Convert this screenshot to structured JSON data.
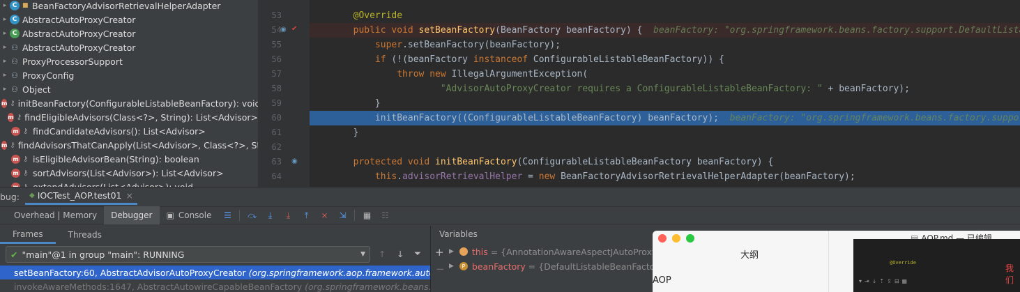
{
  "structure": {
    "items": [
      {
        "label": "BeanFactoryAdvisorRetrievalHelperAdapter",
        "icon": "class-icon",
        "mark": "lock"
      },
      {
        "label": "AbstractAutoProxyCreator",
        "icon": "class-icon"
      },
      {
        "label": "AbstractAutoProxyCreator",
        "icon": "class-icon"
      },
      {
        "label": "AbstractAutoProxyCreator",
        "icon": "hierarchy-icon"
      },
      {
        "label": "ProxyProcessorSupport",
        "icon": "hierarchy-icon"
      },
      {
        "label": "ProxyConfig",
        "icon": "hierarchy-icon"
      },
      {
        "label": "Object",
        "icon": "hierarchy-icon"
      },
      {
        "label": "initBeanFactory(ConfigurableListableBeanFactory): void",
        "icon": "method-icon"
      },
      {
        "label": "findEligibleAdvisors(Class<?>, String): List<Advisor>",
        "icon": "method-icon"
      },
      {
        "label": "findCandidateAdvisors(): List<Advisor>",
        "icon": "method-icon"
      },
      {
        "label": "findAdvisorsThatCanApply(List<Advisor>, Class<?>, String): List<Advisor>",
        "icon": "method-icon"
      },
      {
        "label": "isEligibleAdvisorBean(String): boolean",
        "icon": "method-icon"
      },
      {
        "label": "sortAdvisors(List<Advisor>): List<Advisor>",
        "icon": "method-icon"
      },
      {
        "label": "extendAdvisors(List<Advisor>): void",
        "icon": "method-icon"
      }
    ]
  },
  "editor": {
    "lines": [
      {
        "num": "53",
        "tokens": [
          {
            "t": "    ",
            "c": ""
          },
          {
            "t": "@Override",
            "c": "an"
          }
        ]
      },
      {
        "num": "54",
        "tokens": [
          {
            "t": "    ",
            "c": ""
          },
          {
            "t": "public void ",
            "c": "k"
          },
          {
            "t": "setBeanFactory",
            "c": "f"
          },
          {
            "t": "(BeanFactory beanFactory) {  ",
            "c": ""
          },
          {
            "t": "beanFactory: \"org.springframework.beans.factory.support.DefaultListableBea",
            "c": "hint"
          }
        ]
      },
      {
        "num": "55",
        "tokens": [
          {
            "t": "        ",
            "c": ""
          },
          {
            "t": "super",
            "c": "k"
          },
          {
            "t": ".setBeanFactory(beanFactory);",
            "c": ""
          }
        ]
      },
      {
        "num": "56",
        "tokens": [
          {
            "t": "        ",
            "c": ""
          },
          {
            "t": "if ",
            "c": "k"
          },
          {
            "t": "(!(beanFactory ",
            "c": ""
          },
          {
            "t": "instanceof ",
            "c": "k"
          },
          {
            "t": "ConfigurableListableBeanFactory)) {",
            "c": ""
          }
        ]
      },
      {
        "num": "57",
        "tokens": [
          {
            "t": "            ",
            "c": ""
          },
          {
            "t": "throw new ",
            "c": "k"
          },
          {
            "t": "IllegalArgumentException(",
            "c": ""
          }
        ]
      },
      {
        "num": "58",
        "tokens": [
          {
            "t": "                    ",
            "c": ""
          },
          {
            "t": "\"AdvisorAutoProxyCreator requires a ConfigurableListableBeanFactory: \"",
            "c": "s"
          },
          {
            "t": " + beanFactory);",
            "c": ""
          }
        ]
      },
      {
        "num": "59",
        "tokens": [
          {
            "t": "        }",
            "c": ""
          }
        ]
      },
      {
        "num": "60",
        "tokens": [
          {
            "t": "        initBeanFactory((ConfigurableListableBeanFactory) beanFactory);  ",
            "c": ""
          },
          {
            "t": "beanFactory: \"org.springframework.beans.factory.support.Defau",
            "c": "hint"
          }
        ]
      },
      {
        "num": "61",
        "tokens": [
          {
            "t": "    }",
            "c": ""
          }
        ]
      },
      {
        "num": "62",
        "tokens": []
      },
      {
        "num": "63",
        "tokens": [
          {
            "t": "    ",
            "c": ""
          },
          {
            "t": "protected void ",
            "c": "k"
          },
          {
            "t": "initBeanFactory",
            "c": "f"
          },
          {
            "t": "(ConfigurableListableBeanFactory beanFactory) {",
            "c": ""
          }
        ]
      },
      {
        "num": "64",
        "tokens": [
          {
            "t": "        ",
            "c": ""
          },
          {
            "t": "this",
            "c": "k"
          },
          {
            "t": ".",
            "c": ""
          },
          {
            "t": "advisorRetrievalHelper",
            "c": "fld"
          },
          {
            "t": " = ",
            "c": ""
          },
          {
            "t": "new ",
            "c": "k"
          },
          {
            "t": "BeanFactoryAdvisorRetrievalHelperAdapter(beanFactory);",
            "c": ""
          }
        ]
      }
    ],
    "current_line": "60",
    "breakpoint_line": "54"
  },
  "debug": {
    "title_prefix": "bug:",
    "config_name": "IOCTest_AOP.test01",
    "tabs": [
      "Overhead | Memory",
      "Debugger",
      "Console"
    ],
    "active_tab": "Debugger",
    "frames_tab": "Frames",
    "threads_tab": "Threads",
    "thread_select": "\"main\"@1 in group \"main\": RUNNING",
    "frames": [
      {
        "method": "setBeanFactory:60, AbstractAdvisorAutoProxyCreator",
        "pkg": "(org.springframework.aop.framework.autoproxy)"
      },
      {
        "method": "invokeAwareMethods:1647, AbstractAutowireCapableBeanFactory",
        "pkg": "(org.springframework.beans.factory"
      }
    ],
    "variables_title": "Variables",
    "variables": [
      {
        "name": "this",
        "value": "= {AnnotationAwareAspectJAutoProxyC"
      },
      {
        "name": "beanFactory",
        "value": "= {DefaultListableBeanFactory@"
      }
    ]
  },
  "overlay": {
    "outline_title": "大纲",
    "outline_item": "AOP",
    "doc_title": "AOP.md — 已编辑",
    "preview_text": "我们",
    "preview_code": "@Override"
  }
}
